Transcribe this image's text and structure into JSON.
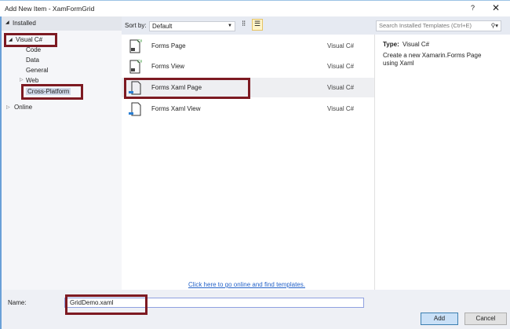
{
  "window": {
    "title": "Add New Item - XamFormGrid",
    "help": "?",
    "close": "✕"
  },
  "tree": {
    "installed": "Installed",
    "visual_csharp": "Visual C#",
    "children": [
      "Code",
      "Data",
      "General"
    ],
    "web": "Web",
    "cross_platform": "Cross-Platform",
    "online": "Online"
  },
  "toolbar": {
    "sort_label": "Sort by:",
    "sort_value": "Default",
    "search_placeholder": "Search Installed Templates (Ctrl+E)"
  },
  "templates": [
    {
      "name": "Forms Page",
      "language": "Visual C#"
    },
    {
      "name": "Forms View",
      "language": "Visual C#"
    },
    {
      "name": "Forms Xaml Page",
      "language": "Visual C#",
      "selected": true
    },
    {
      "name": "Forms Xaml View",
      "language": "Visual C#"
    }
  ],
  "details": {
    "type_label": "Type:",
    "type_value": "Visual C#",
    "description": "Create a new Xamarin.Forms Page using Xaml"
  },
  "online_link": "Click here to go online and find templates.",
  "footer": {
    "name_label": "Name:",
    "name_value": "GridDemo.xaml",
    "add": "Add",
    "cancel": "Cancel"
  }
}
